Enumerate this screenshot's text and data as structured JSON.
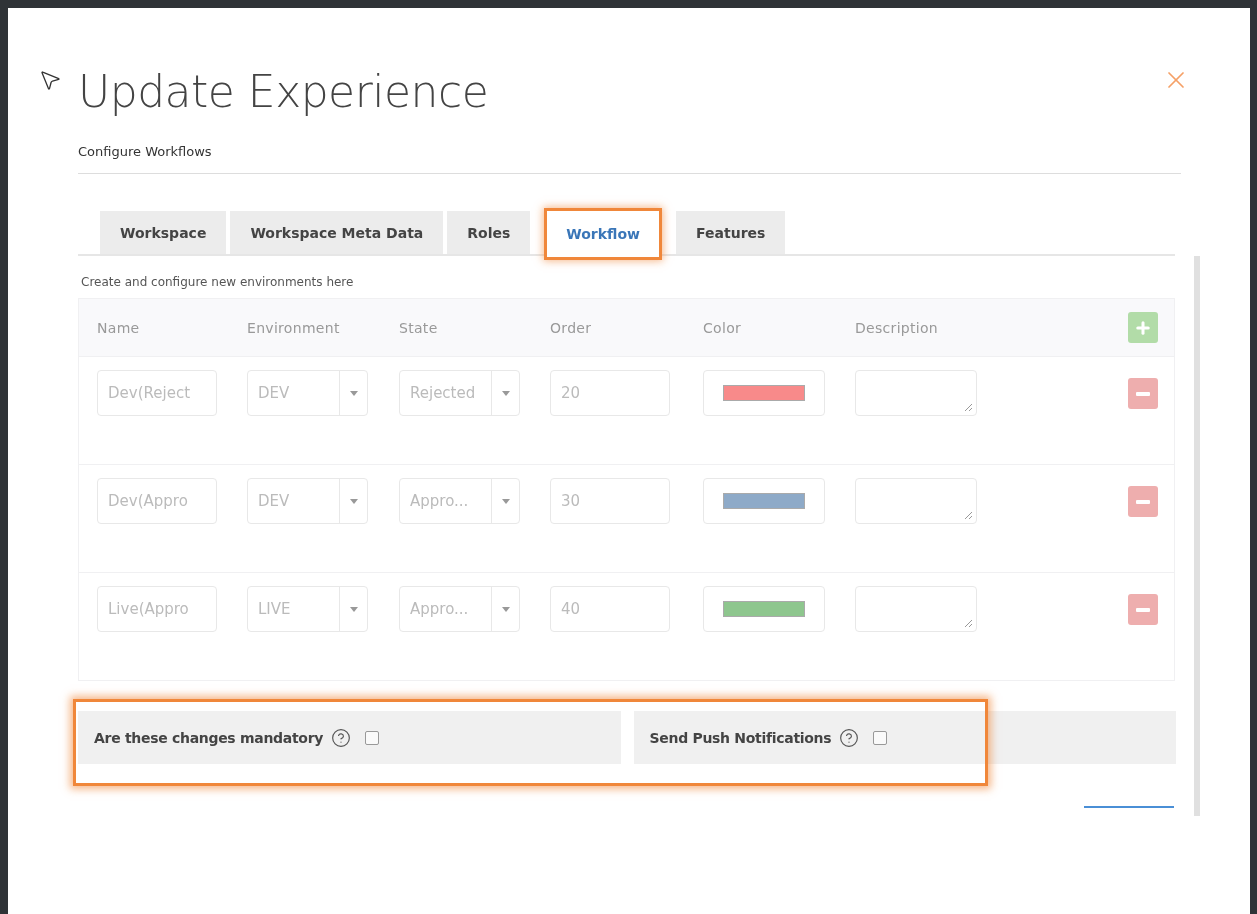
{
  "dialog": {
    "title": "Update Experience",
    "subtitle": "Configure Workflows"
  },
  "tabs": [
    {
      "label": "Workspace",
      "selected": false,
      "highlighted": false
    },
    {
      "label": "Workspace Meta Data",
      "selected": false,
      "highlighted": false
    },
    {
      "label": "Roles",
      "selected": false,
      "highlighted": false
    },
    {
      "label": "Workflow",
      "selected": true,
      "highlighted": true
    },
    {
      "label": "Features",
      "selected": false,
      "highlighted": false
    }
  ],
  "hint": "Create and configure new environments here",
  "table": {
    "columns": [
      "Name",
      "Environment",
      "State",
      "Order",
      "Color",
      "Description"
    ],
    "rows": [
      {
        "name": "Dev(Reject",
        "environment": "DEV",
        "state": "Rejected",
        "order": "20",
        "color": "#f88a8a"
      },
      {
        "name": "Dev(Appro",
        "environment": "DEV",
        "state": "Appro...",
        "order": "30",
        "color": "#8eaac8"
      },
      {
        "name": "Live(Appro",
        "environment": "LIVE",
        "state": "Appro...",
        "order": "40",
        "color": "#8ec68e"
      }
    ]
  },
  "options": {
    "highlighted": true,
    "items": [
      {
        "label": "Are these changes mandatory",
        "checked": false
      },
      {
        "label": "Send Push Notifications",
        "checked": false
      }
    ]
  }
}
